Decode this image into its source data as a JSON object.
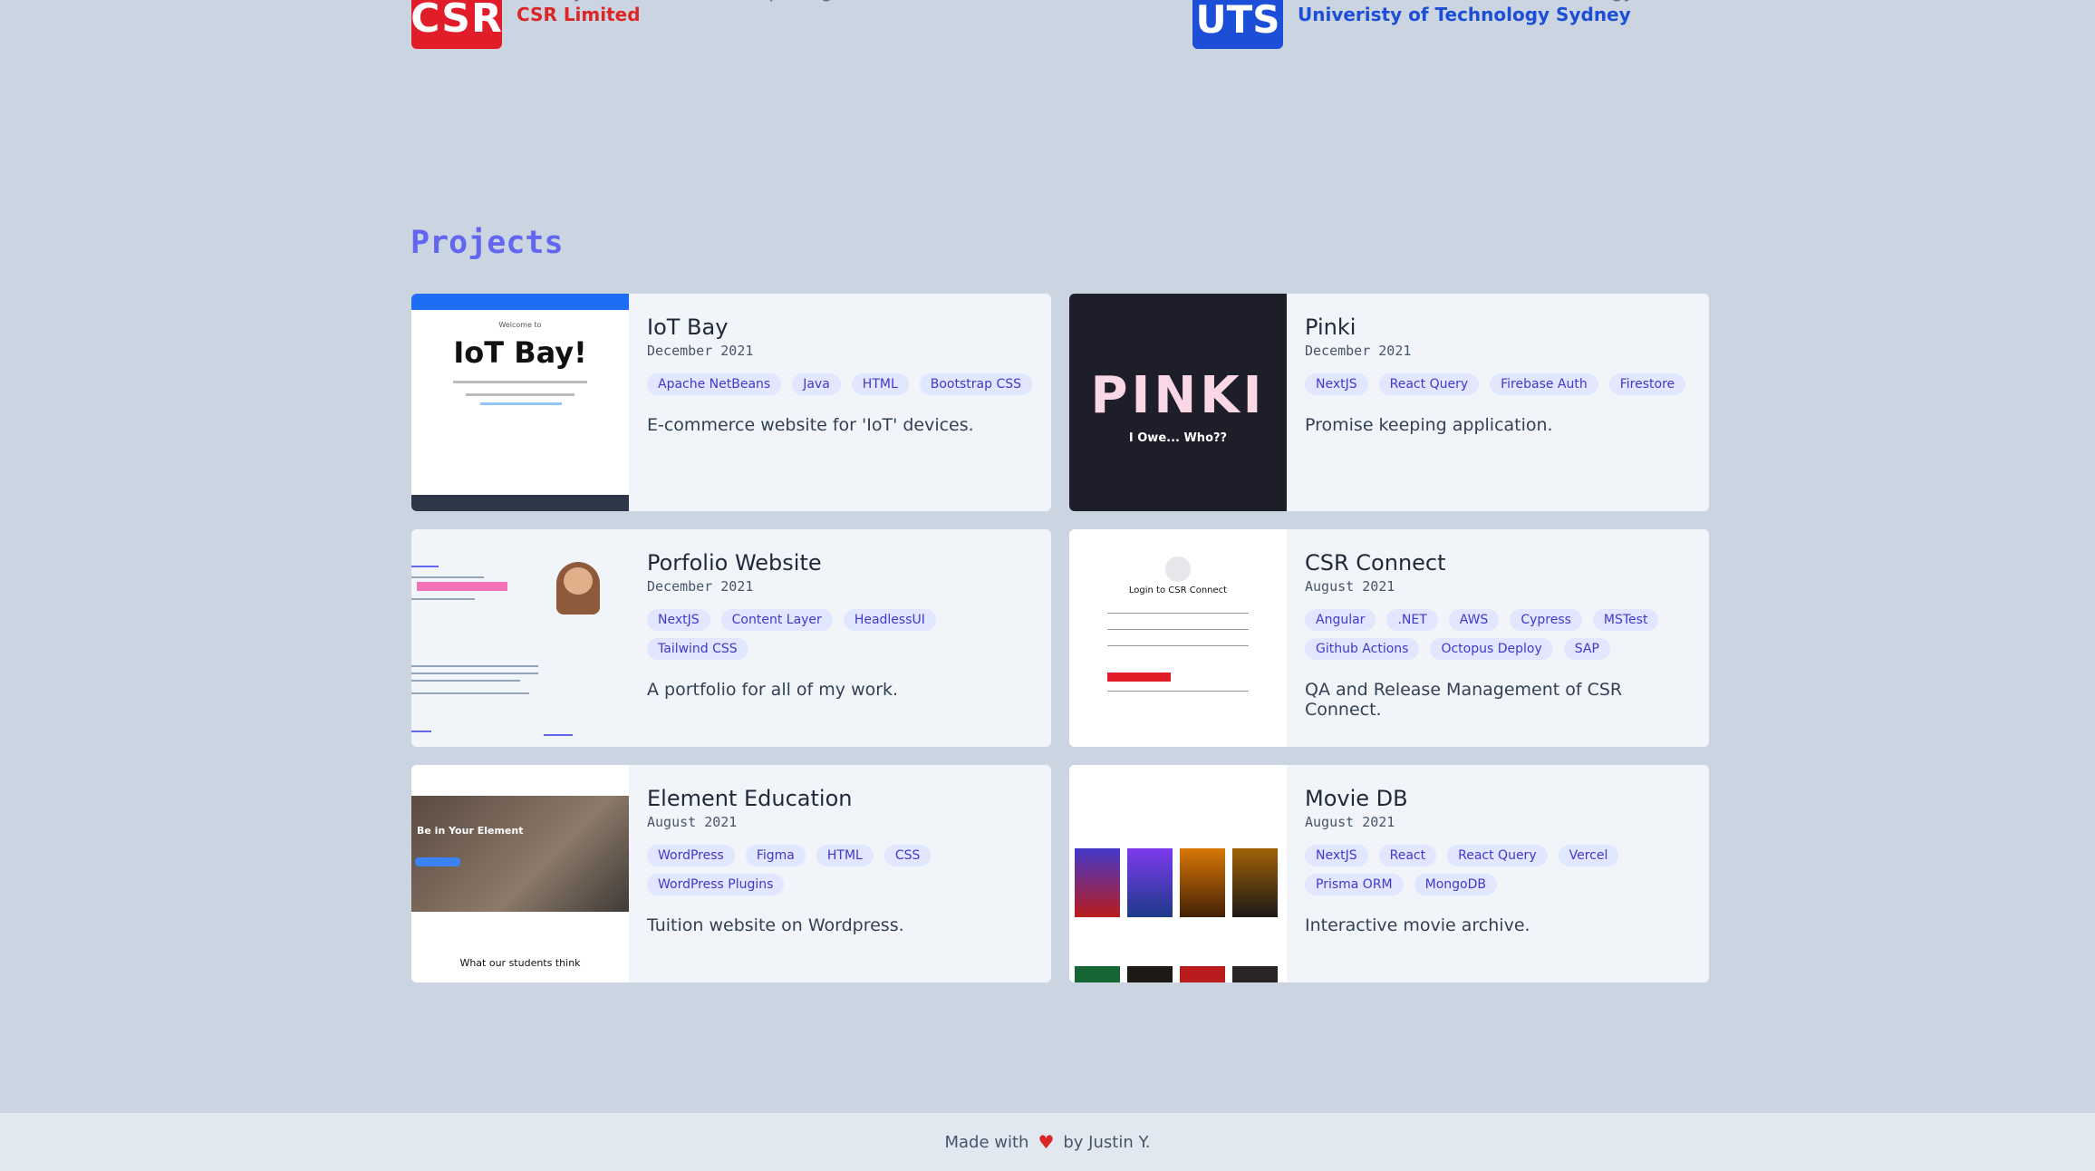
{
  "experience": [
    {
      "role": "Quality Assurance & DevOps Engineer",
      "org": "CSR Limited",
      "logo": "CSR",
      "color": "#e11d2a"
    },
    {
      "role": "Bachelor of Information Technology",
      "org": "Univeristy of Technology Sydney",
      "logo": "UTS",
      "color": "#1d4ed8"
    }
  ],
  "projects_section": {
    "title": "Projects",
    "items": [
      {
        "title": "IoT Bay",
        "date": "December 2021",
        "tags": [
          "Apache NetBeans",
          "Java",
          "HTML",
          "Bootstrap CSS"
        ],
        "description": "E-commerce website for 'IoT' devices.",
        "thumb_text": "IoT Bay!"
      },
      {
        "title": "Pinki",
        "date": "December 2021",
        "tags": [
          "NextJS",
          "React Query",
          "Firebase Auth",
          "Firestore"
        ],
        "description": "Promise keeping application.",
        "thumb_text": "PINKI",
        "thumb_sub": "I Owe... Who??"
      },
      {
        "title": "Porfolio Website",
        "date": "December 2021",
        "tags": [
          "NextJS",
          "Content Layer",
          "HeadlessUI",
          "Tailwind CSS"
        ],
        "description": "A portfolio for all of my work."
      },
      {
        "title": "CSR Connect",
        "date": "August 2021",
        "tags": [
          "Angular",
          ".NET",
          "AWS",
          "Cypress",
          "MSTest",
          "Github Actions",
          "Octopus Deploy",
          "SAP"
        ],
        "description": "QA and Release Management of CSR Connect.",
        "thumb_text": "Login to CSR Connect"
      },
      {
        "title": "Element Education",
        "date": "August 2021",
        "tags": [
          "WordPress",
          "Figma",
          "HTML",
          "CSS",
          "WordPress Plugins"
        ],
        "description": "Tuition website on Wordpress.",
        "thumb_text": "Be in Your Element",
        "thumb_sub": "What our students think"
      },
      {
        "title": "Movie DB",
        "date": "August 2021",
        "tags": [
          "NextJS",
          "React",
          "React Query",
          "Vercel",
          "Prisma ORM",
          "MongoDB"
        ],
        "description": "Interactive movie archive."
      }
    ]
  },
  "footer": {
    "prefix": "Made with",
    "heart": "♥",
    "suffix": "by Justin Y."
  }
}
